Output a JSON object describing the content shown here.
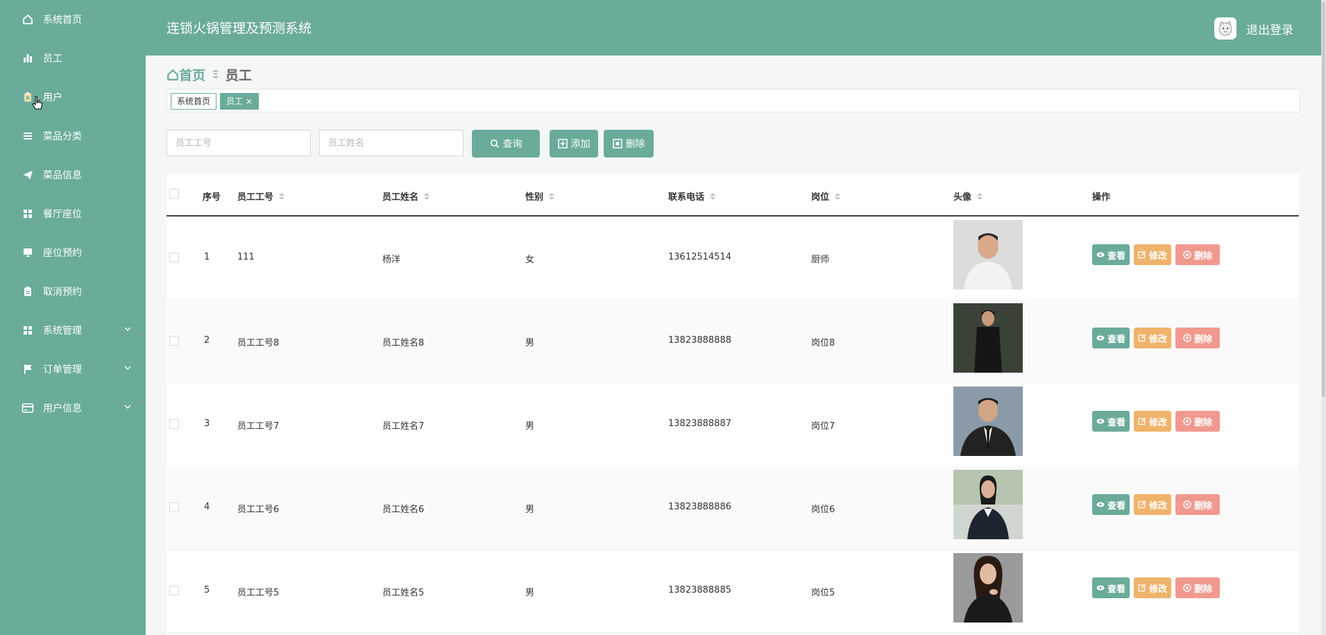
{
  "app_title": "连锁火锅管理及预测系统",
  "logout_label": "退出登录",
  "colors": {
    "primary": "#6aab9b",
    "warning": "#f0b36c",
    "danger": "#f1998f"
  },
  "sidebar": {
    "items": [
      {
        "label": "系统首页",
        "icon": "home-icon"
      },
      {
        "label": "员工",
        "icon": "bar-chart-icon"
      },
      {
        "label": "用户",
        "icon": "clipboard-icon"
      },
      {
        "label": "菜品分类",
        "icon": "list-icon"
      },
      {
        "label": "菜品信息",
        "icon": "paper-plane-icon"
      },
      {
        "label": "餐厅座位",
        "icon": "grid-icon"
      },
      {
        "label": "座位预约",
        "icon": "monitor-icon"
      },
      {
        "label": "取消预约",
        "icon": "clipboard-icon"
      },
      {
        "label": "系统管理",
        "icon": "grid-icon",
        "expandable": true
      },
      {
        "label": "订单管理",
        "icon": "flag-icon",
        "expandable": true
      },
      {
        "label": "用户信息",
        "icon": "card-icon",
        "expandable": true
      }
    ]
  },
  "breadcrumb": {
    "home": "首页",
    "current": "员工"
  },
  "tabs": [
    {
      "label": "系统首页"
    },
    {
      "label": "员工"
    }
  ],
  "search": {
    "employee_no_placeholder": "员工工号",
    "employee_name_placeholder": "员工姓名",
    "query_label": "查询",
    "add_label": "添加",
    "delete_label": "删除"
  },
  "table": {
    "columns": [
      "序号",
      "员工工号",
      "员工姓名",
      "性别",
      "联系电话",
      "岗位",
      "头像",
      "操作"
    ],
    "rows": [
      {
        "index": "1",
        "emp_no": "111",
        "name": "杨洋",
        "gender": "女",
        "phone": "13612514514",
        "position": "厨师"
      },
      {
        "index": "2",
        "emp_no": "员工工号8",
        "name": "员工姓名8",
        "gender": "男",
        "phone": "13823888888",
        "position": "岗位8"
      },
      {
        "index": "3",
        "emp_no": "员工工号7",
        "name": "员工姓名7",
        "gender": "男",
        "phone": "13823888887",
        "position": "岗位7"
      },
      {
        "index": "4",
        "emp_no": "员工工号6",
        "name": "员工姓名6",
        "gender": "男",
        "phone": "13823888886",
        "position": "岗位6"
      },
      {
        "index": "5",
        "emp_no": "员工工号5",
        "name": "员工姓名5",
        "gender": "男",
        "phone": "13823888885",
        "position": "岗位5"
      }
    ],
    "actions": {
      "view": "查看",
      "edit": "修改",
      "delete": "删除"
    }
  }
}
